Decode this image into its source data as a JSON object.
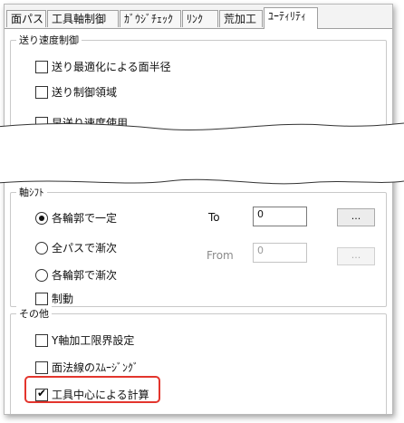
{
  "tabs": [
    "面パス",
    "工具軸制御",
    "ｶﾞｳｼﾞﾁｪｯｸ",
    "ﾘﾝｸ",
    "荒加工",
    "ﾕｰﾃｨﾘﾃｨ"
  ],
  "feed_group": {
    "title": "送り速度制御",
    "options": [
      "送り最適化による面半径",
      "送り制御領域",
      "早送り速度使用"
    ]
  },
  "axis_group": {
    "title": "軸ｼﾌﾄ",
    "radios": [
      "各輪郭で一定",
      "全パスで漸次",
      "各輪郭で漸次"
    ],
    "to_label": "To",
    "to_value": "0",
    "from_label": "From",
    "from_value": "0",
    "button_label": "...",
    "brake_label": "制動"
  },
  "other_group": {
    "title": "その他",
    "options": [
      "Y軸加工限界設定",
      "面法線のｽﾑｰｼﾞﾝｸﾞ",
      "工具中心による計算"
    ],
    "checked_index": 2
  },
  "colors": {
    "highlight": "#e3352d"
  }
}
